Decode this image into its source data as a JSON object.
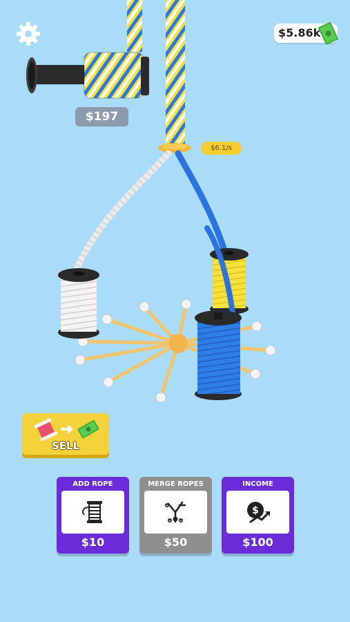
{
  "hud": {
    "money": "$5.86k",
    "settings_icon": "gear-icon",
    "money_icon": "cash-icon"
  },
  "spool": {
    "price": "$197"
  },
  "hook": {
    "rate": "$6.1/s"
  },
  "sell_button": {
    "label": "SELL",
    "icons": [
      "spool-icon",
      "arrow-right-icon",
      "cash-icon"
    ]
  },
  "upgrades": [
    {
      "title": "ADD ROPE",
      "price": "$10",
      "icon": "spool-icon",
      "enabled": true
    },
    {
      "title": "MERGE ROPES",
      "price": "$50",
      "icon": "merge-icon",
      "enabled": false
    },
    {
      "title": "INCOME",
      "price": "$100",
      "icon": "income-icon",
      "enabled": true
    }
  ],
  "colors": {
    "background": "#a9dcf9",
    "rope_blue": "#2a78e4",
    "rope_yellow": "#f6e23a",
    "rope_white": "#f2f2f2",
    "peg_arm": "#f4c46c",
    "button_yellow": "#f6d23a",
    "card_purple": "#6b2bd9",
    "card_gray": "#8f8f8f"
  }
}
